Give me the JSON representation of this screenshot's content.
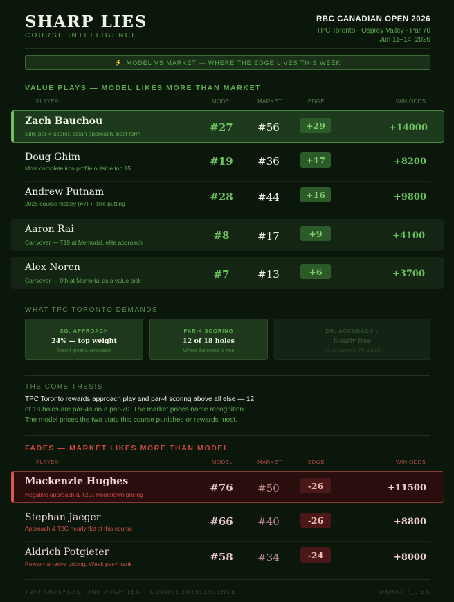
{
  "header": {
    "brand": "SHARP LIES",
    "subtitle": "COURSE INTELLIGENCE",
    "event": "RBC CANADIAN OPEN 2026",
    "venue": "TPC Toronto · Osprey Valley · Par 70",
    "dates": "Jun 11–14, 2026"
  },
  "banner": {
    "icon": "⚡",
    "text": "MODEL VS MARKET — WHERE THE EDGE LIVES THIS WEEK"
  },
  "value_plays": {
    "title": "VALUE PLAYS — MODEL LIKES MORE THAN MARKET",
    "columns": {
      "player": "PLAYER",
      "model": "MODEL",
      "market": "MARKET",
      "edge": "EDGE",
      "odds": "WIN ODDS"
    },
    "rows": [
      {
        "name": "Zach Bauchou",
        "desc": "Elite par-4 scorer, clean approach, best form",
        "model": "#27",
        "market": "#56",
        "edge": "+29",
        "odds": "+14000"
      },
      {
        "name": "Doug Ghim",
        "desc": "Most complete iron profile outside top 15",
        "model": "#19",
        "market": "#36",
        "edge": "+17",
        "odds": "+8200"
      },
      {
        "name": "Andrew Putnam",
        "desc": "2025 course history (#7) + elite putting",
        "model": "#28",
        "market": "#44",
        "edge": "+16",
        "odds": "+9800"
      },
      {
        "name": "Aaron Rai",
        "desc": "Carryover — T19 at Memorial, elite approach",
        "model": "#8",
        "market": "#17",
        "edge": "+9",
        "odds": "+4100"
      },
      {
        "name": "Alex Noren",
        "desc": "Carryover — 9th at Memorial as a value pick",
        "model": "#7",
        "market": "#13",
        "edge": "+6",
        "odds": "+3700"
      }
    ]
  },
  "demands": {
    "title": "WHAT TPC TORONTO DEMANDS",
    "cards": [
      {
        "label": "SG: APPROACH",
        "value": "24% — top weight",
        "sub": "Runoff greens, renovated"
      },
      {
        "label": "PAR-4 SCORING",
        "value": "12 of 18 holes",
        "sub": "Where the round is won"
      },
      {
        "label": "DR. ACCURACY ↓",
        "value": "Nearly free",
        "sub": "57-yd fairways, 7% added"
      }
    ]
  },
  "thesis": {
    "title": "THE CORE THESIS",
    "line1": "TPC Toronto rewards approach play and par-4 scoring above all else — 12",
    "line2": "of 18 holes are par-4s on a par-70. The market prices name recognition.",
    "line3": "The model prices the two stats this course punishes or rewards most."
  },
  "fades": {
    "title": "FADES — MARKET LIKES MORE THAN MODEL",
    "columns": {
      "player": "PLAYER",
      "model": "MODEL",
      "market": "MARKET",
      "edge": "EDGE",
      "odds": "WIN ODDS"
    },
    "rows": [
      {
        "name": "Mackenzie Hughes",
        "desc": "Negative approach & T2G. Hometown pricing",
        "model": "#76",
        "market": "#50",
        "edge": "-26",
        "odds": "+11500"
      },
      {
        "name": "Stephan Jaeger",
        "desc": "Approach & T2G nearly flat at this course",
        "model": "#66",
        "market": "#40",
        "edge": "-26",
        "odds": "+8800"
      },
      {
        "name": "Aldrich Potgieter",
        "desc": "Power-narrative pricing. Weak par-4 rank",
        "model": "#58",
        "market": "#34",
        "edge": "-24",
        "odds": "+8000"
      }
    ]
  },
  "footer": {
    "left": "TWO ANALYSTS. ONE ARCHITECT. COURSE INTELLIGENCE.",
    "right": "@SHARP_LIES"
  },
  "colors": {
    "background": "#0c170c",
    "accent_green": "#6cc05e",
    "accent_red": "#d55a4c",
    "text": "#eef3e6"
  }
}
